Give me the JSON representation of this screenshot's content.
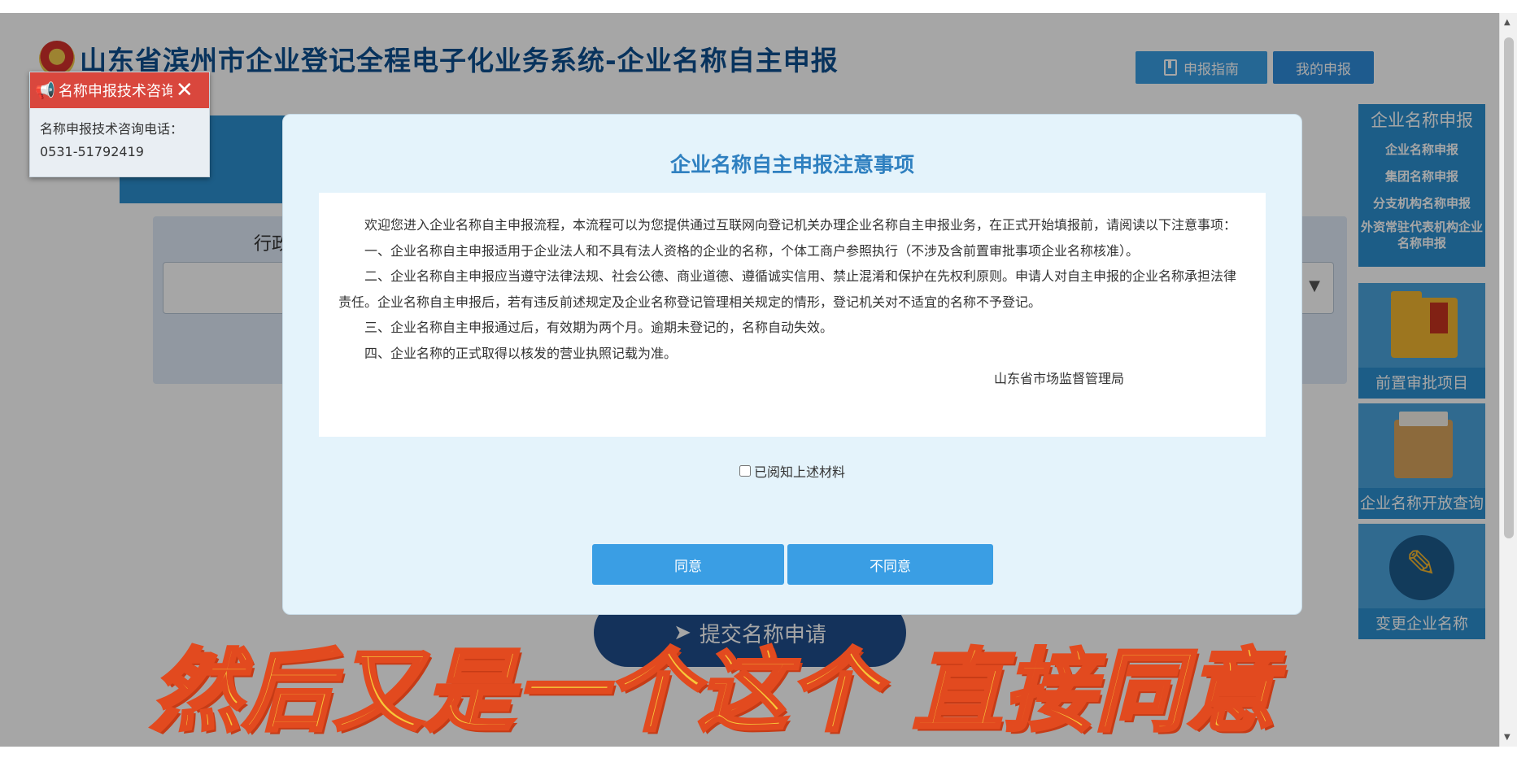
{
  "page": {
    "title": "山东省滨州市企业登记全程电子化业务系统-企业名称自主申报",
    "header_buttons": {
      "guide": "申报指南",
      "my_applications": "我的申报"
    },
    "form": {
      "label": "行政"
    },
    "submit_label": "提交名称申请"
  },
  "sidebar": {
    "title": "企业名称申报",
    "items": [
      {
        "label": "企业名称申报"
      },
      {
        "label": "集团名称申报"
      },
      {
        "label": "分支机构名称申报"
      },
      {
        "label": "外资常驻代表机构企业名称申报"
      }
    ],
    "cards": [
      {
        "label": "前置审批项目"
      },
      {
        "label": "企业名称开放查询"
      },
      {
        "label": "变更企业名称"
      }
    ]
  },
  "consult_popup": {
    "title": "名称申报技术咨询",
    "body_line1": "名称申报技术咨询电话：",
    "body_line2": "0531-51792419"
  },
  "modal": {
    "title": "企业名称自主申报注意事项",
    "paragraphs": [
      "欢迎您进入企业名称自主申报流程，本流程可以为您提供通过互联网向登记机关办理企业名称自主申报业务，在正式开始填报前，请阅读以下注意事项：",
      "一、企业名称自主申报适用于企业法人和不具有法人资格的企业的名称，个体工商户参照执行（不涉及含前置审批事项企业名称核准）。",
      "二、企业名称自主申报应当遵守法律法规、社会公德、商业道德、遵循诚实信用、禁止混淆和保护在先权利原则。申请人对自主申报的企业名称承担法律责任。企业名称自主申报后，若有违反前述规定及企业名称登记管理相关规定的情形，登记机关对不适宜的名称不予登记。",
      "三、企业名称自主申报通过后，有效期为两个月。逾期未登记的，名称自动失效。",
      "四、企业名称的正式取得以核发的营业执照记载为准。"
    ],
    "signature": "山东省市场监督管理局",
    "checkbox_label": "已阅知上述材料",
    "agree_label": "同意",
    "disagree_label": "不同意"
  },
  "caption": "然后又是一个这个 直接同意"
}
